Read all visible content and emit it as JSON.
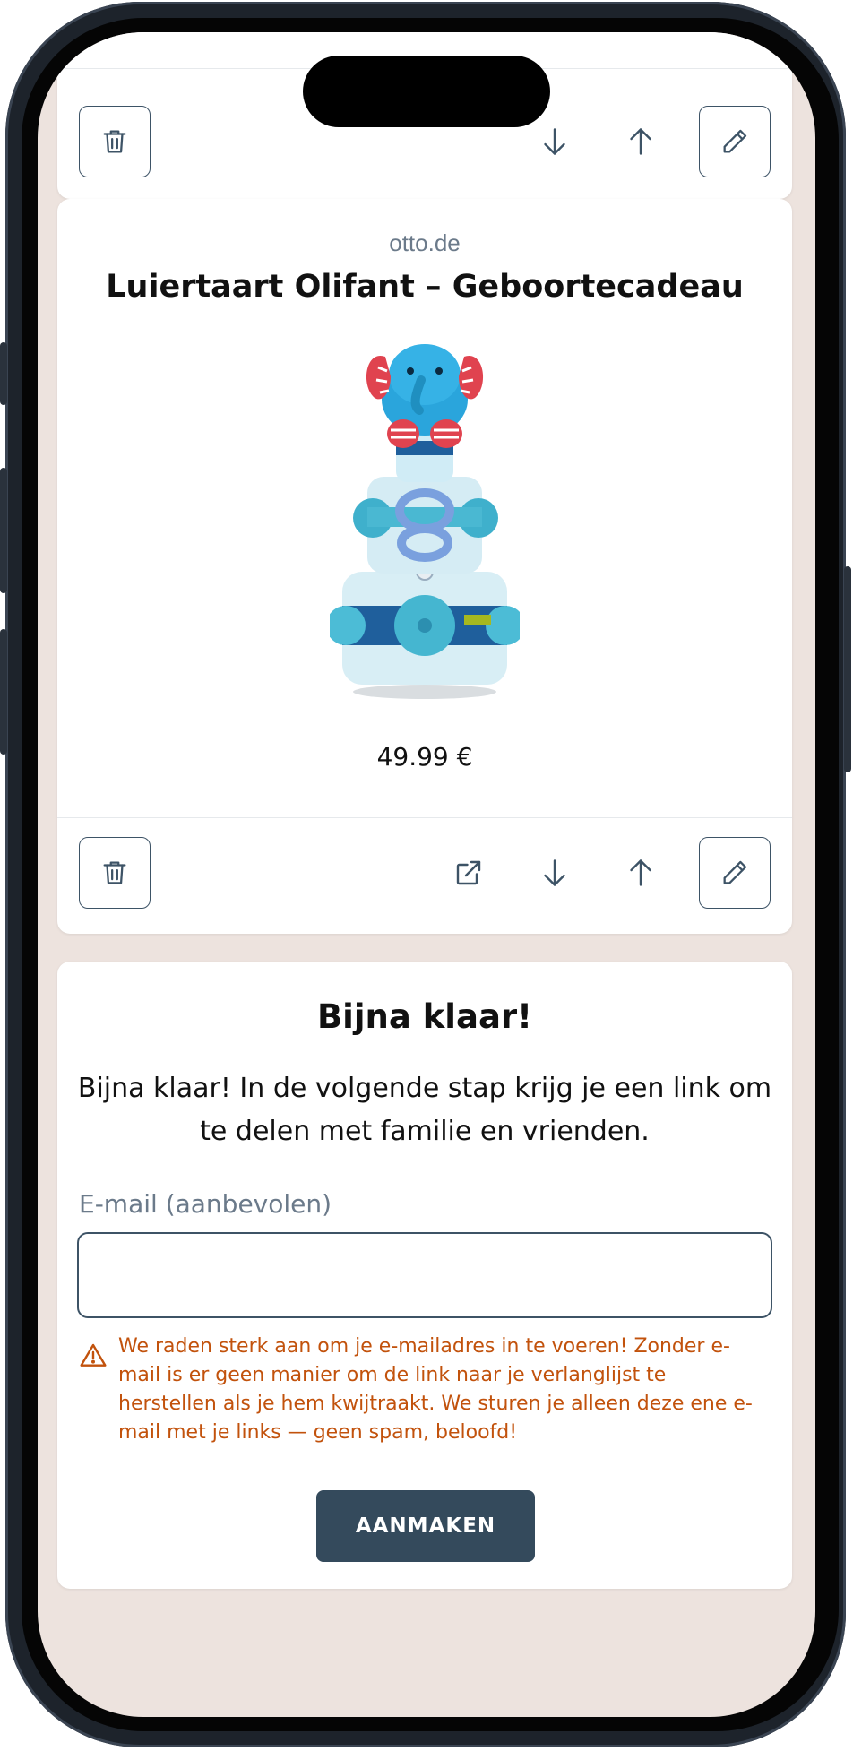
{
  "top_card": {
    "delete_icon": "trash-icon",
    "move_down_icon": "arrow-down-icon",
    "move_up_icon": "arrow-up-icon",
    "edit_icon": "pencil-icon"
  },
  "product": {
    "domain": "otto.de",
    "title": "Luiertaart Olifant – Geboortecadeau",
    "image": "diaper-cake-elephant",
    "price": "49.99 €",
    "actions": [
      "trash-icon",
      "external-link-icon",
      "arrow-down-icon",
      "arrow-up-icon",
      "pencil-icon"
    ]
  },
  "finish": {
    "heading": "Bijna klaar!",
    "description": "Bijna klaar! In de volgende stap krijg je een link om te delen met familie en vrienden.",
    "email_label": "E-mail (aanbevolen)",
    "email_value": "",
    "email_placeholder": "",
    "warning": "We raden sterk aan om je e-mailadres in te voeren! Zonder e-mail is er geen manier om de link naar je verlanglijst te herstellen als je hem kwijtraakt. We sturen je alleen deze ene e-mail met je links — geen spam, beloofd!",
    "submit_label": "AANMAKEN"
  },
  "colors": {
    "background": "#ede3de",
    "primary": "#344a5c",
    "warning": "#c2520c",
    "muted": "#6b7a8a"
  }
}
